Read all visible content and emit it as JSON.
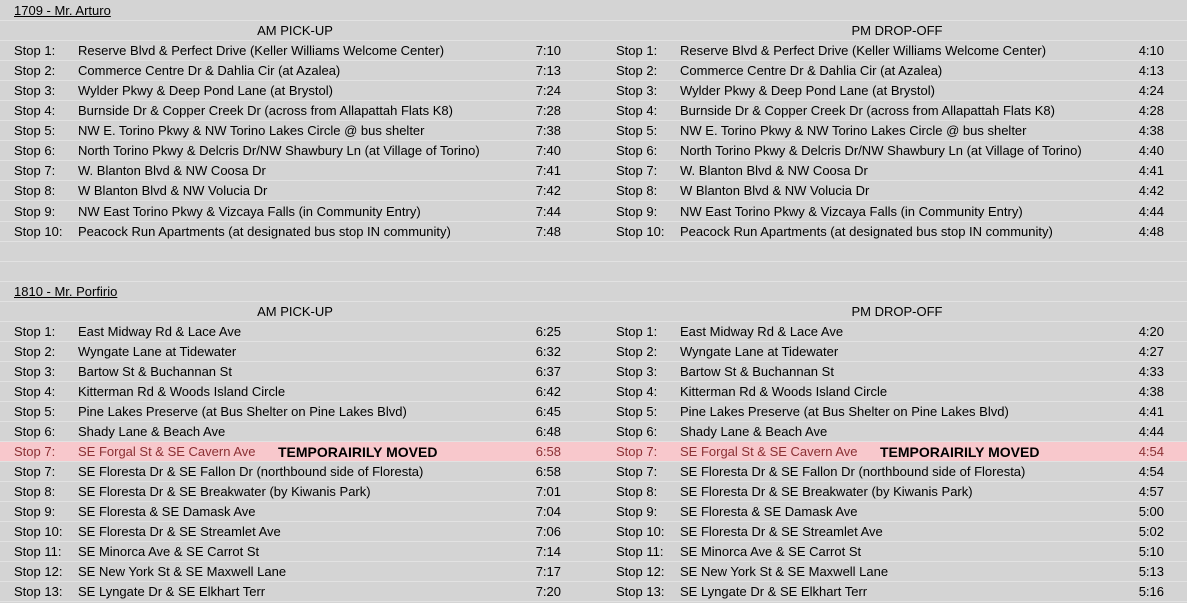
{
  "bus1": {
    "title": "1709 - Mr. Arturo",
    "am_header": "AM PICK-UP",
    "pm_header": "PM DROP-OFF",
    "stops": [
      {
        "stop": "Stop 1:",
        "am_loc": "Reserve Blvd & Perfect Drive (Keller Williams Welcome Center)",
        "am_time": "7:10",
        "pm_loc": "Reserve Blvd & Perfect Drive (Keller Williams Welcome Center)",
        "pm_time": "4:10"
      },
      {
        "stop": "Stop 2:",
        "am_loc": "Commerce Centre Dr & Dahlia Cir (at Azalea)",
        "am_time": "7:13",
        "pm_loc": "Commerce Centre Dr & Dahlia Cir (at Azalea)",
        "pm_time": "4:13"
      },
      {
        "stop": "Stop 3:",
        "am_loc": "Wylder Pkwy & Deep Pond Lane (at Brystol)",
        "am_time": "7:24",
        "pm_loc": "Wylder Pkwy & Deep Pond Lane (at Brystol)",
        "pm_time": "4:24"
      },
      {
        "stop": "Stop 4:",
        "am_loc": "Burnside Dr & Copper Creek Dr (across from Allapattah Flats K8)",
        "am_time": "7:28",
        "pm_loc": "Burnside Dr & Copper Creek Dr (across from Allapattah Flats K8)",
        "pm_time": "4:28"
      },
      {
        "stop": "Stop 5:",
        "am_loc": "NW E. Torino Pkwy & NW Torino Lakes Circle @ bus shelter",
        "am_time": "7:38",
        "pm_loc": "NW E. Torino Pkwy & NW Torino Lakes Circle @ bus shelter",
        "pm_time": "4:38"
      },
      {
        "stop": "Stop 6:",
        "am_loc": "North Torino Pkwy & Delcris Dr/NW Shawbury Ln (at Village of Torino)",
        "am_time": "7:40",
        "pm_loc": "North Torino Pkwy & Delcris Dr/NW Shawbury Ln (at Village of Torino)",
        "pm_time": "4:40"
      },
      {
        "stop": "Stop 7:",
        "am_loc": "W. Blanton Blvd & NW Coosa Dr",
        "am_time": "7:41",
        "pm_loc": "W. Blanton Blvd & NW Coosa Dr",
        "pm_time": "4:41"
      },
      {
        "stop": "Stop 8:",
        "am_loc": "W Blanton Blvd & NW Volucia Dr",
        "am_time": "7:42",
        "pm_loc": "W Blanton Blvd & NW Volucia Dr",
        "pm_time": "4:42"
      },
      {
        "stop": "Stop 9:",
        "am_loc": "NW East Torino Pkwy & Vizcaya Falls (in Community Entry)",
        "am_time": "7:44",
        "pm_loc": "NW East Torino Pkwy & Vizcaya Falls (in Community Entry)",
        "pm_time": "4:44"
      },
      {
        "stop": "Stop 10:",
        "am_loc": "Peacock Run Apartments (at designated bus stop IN community)",
        "am_time": "7:48",
        "pm_loc": "Peacock Run Apartments (at designated bus stop IN community)",
        "pm_time": "4:48"
      }
    ]
  },
  "bus2": {
    "title": "1810 - Mr. Porfirio",
    "am_header": "AM PICK-UP",
    "pm_header": "PM DROP-OFF",
    "stops": [
      {
        "stop": "Stop 1:",
        "am_loc": "East Midway Rd & Lace Ave",
        "am_time": "6:25",
        "pm_loc": "East Midway Rd & Lace Ave",
        "pm_time": "4:20"
      },
      {
        "stop": "Stop 2:",
        "am_loc": "Wyngate Lane at Tidewater",
        "am_time": "6:32",
        "pm_loc": "Wyngate Lane at Tidewater",
        "pm_time": "4:27"
      },
      {
        "stop": "Stop 3:",
        "am_loc": "Bartow St & Buchannan St",
        "am_time": "6:37",
        "pm_loc": "Bartow St & Buchannan St",
        "pm_time": "4:33"
      },
      {
        "stop": "Stop 4:",
        "am_loc": "Kitterman Rd & Woods Island Circle",
        "am_time": "6:42",
        "pm_loc": "Kitterman Rd & Woods Island Circle",
        "pm_time": "4:38"
      },
      {
        "stop": "Stop 5:",
        "am_loc": "Pine Lakes Preserve (at Bus Shelter on Pine Lakes Blvd)",
        "am_time": "6:45",
        "pm_loc": "Pine Lakes Preserve (at Bus Shelter on Pine Lakes Blvd)",
        "pm_time": "4:41"
      },
      {
        "stop": "Stop 6:",
        "am_loc": "Shady Lane & Beach Ave",
        "am_time": "6:48",
        "pm_loc": "Shady Lane & Beach Ave",
        "pm_time": "4:44"
      },
      {
        "stop": "Stop 7:",
        "am_loc": "SE Forgal St & SE Cavern Ave",
        "am_note": "TEMPORAIRILY MOVED",
        "am_time": "6:58",
        "pm_loc": "SE Forgal St & SE Cavern Ave",
        "pm_note": "TEMPORAIRILY MOVED",
        "pm_time": "4:54",
        "highlight": "#f8c8cc"
      },
      {
        "stop": "Stop 7:",
        "am_loc": "SE Floresta Dr & SE Fallon Dr (northbound side of Floresta)",
        "am_time": "6:58",
        "pm_loc": "SE Floresta Dr & SE Fallon Dr (northbound side of Floresta)",
        "pm_time": "4:54"
      },
      {
        "stop": "Stop 8:",
        "am_loc": "SE Floresta Dr & SE Breakwater (by Kiwanis Park)",
        "am_time": "7:01",
        "pm_loc": "SE Floresta Dr & SE Breakwater (by Kiwanis Park)",
        "pm_time": "4:57"
      },
      {
        "stop": "Stop 9:",
        "am_loc": "SE Floresta & SE Damask Ave",
        "am_time": "7:04",
        "pm_loc": "SE Floresta & SE Damask Ave",
        "pm_time": "5:00"
      },
      {
        "stop": "Stop 10:",
        "am_loc": "SE Floresta Dr & SE Streamlet Ave",
        "am_time": "7:06",
        "pm_loc": "SE Floresta Dr & SE Streamlet Ave",
        "pm_time": "5:02"
      },
      {
        "stop": "Stop 11:",
        "am_loc": "SE Minorca Ave & SE Carrot St",
        "am_time": "7:14",
        "pm_loc": "SE Minorca Ave & SE Carrot St",
        "pm_time": "5:10"
      },
      {
        "stop": "Stop 12:",
        "am_loc": "SE New York St & SE Maxwell Lane",
        "am_time": "7:17",
        "pm_loc": "SE New York St & SE Maxwell Lane",
        "pm_time": "5:13"
      },
      {
        "stop": "Stop 13:",
        "am_loc": "SE Lyngate Dr & SE Elkhart Terr",
        "am_time": "7:20",
        "pm_loc": "SE Lyngate Dr & SE Elkhart Terr",
        "pm_time": "5:16"
      }
    ]
  }
}
